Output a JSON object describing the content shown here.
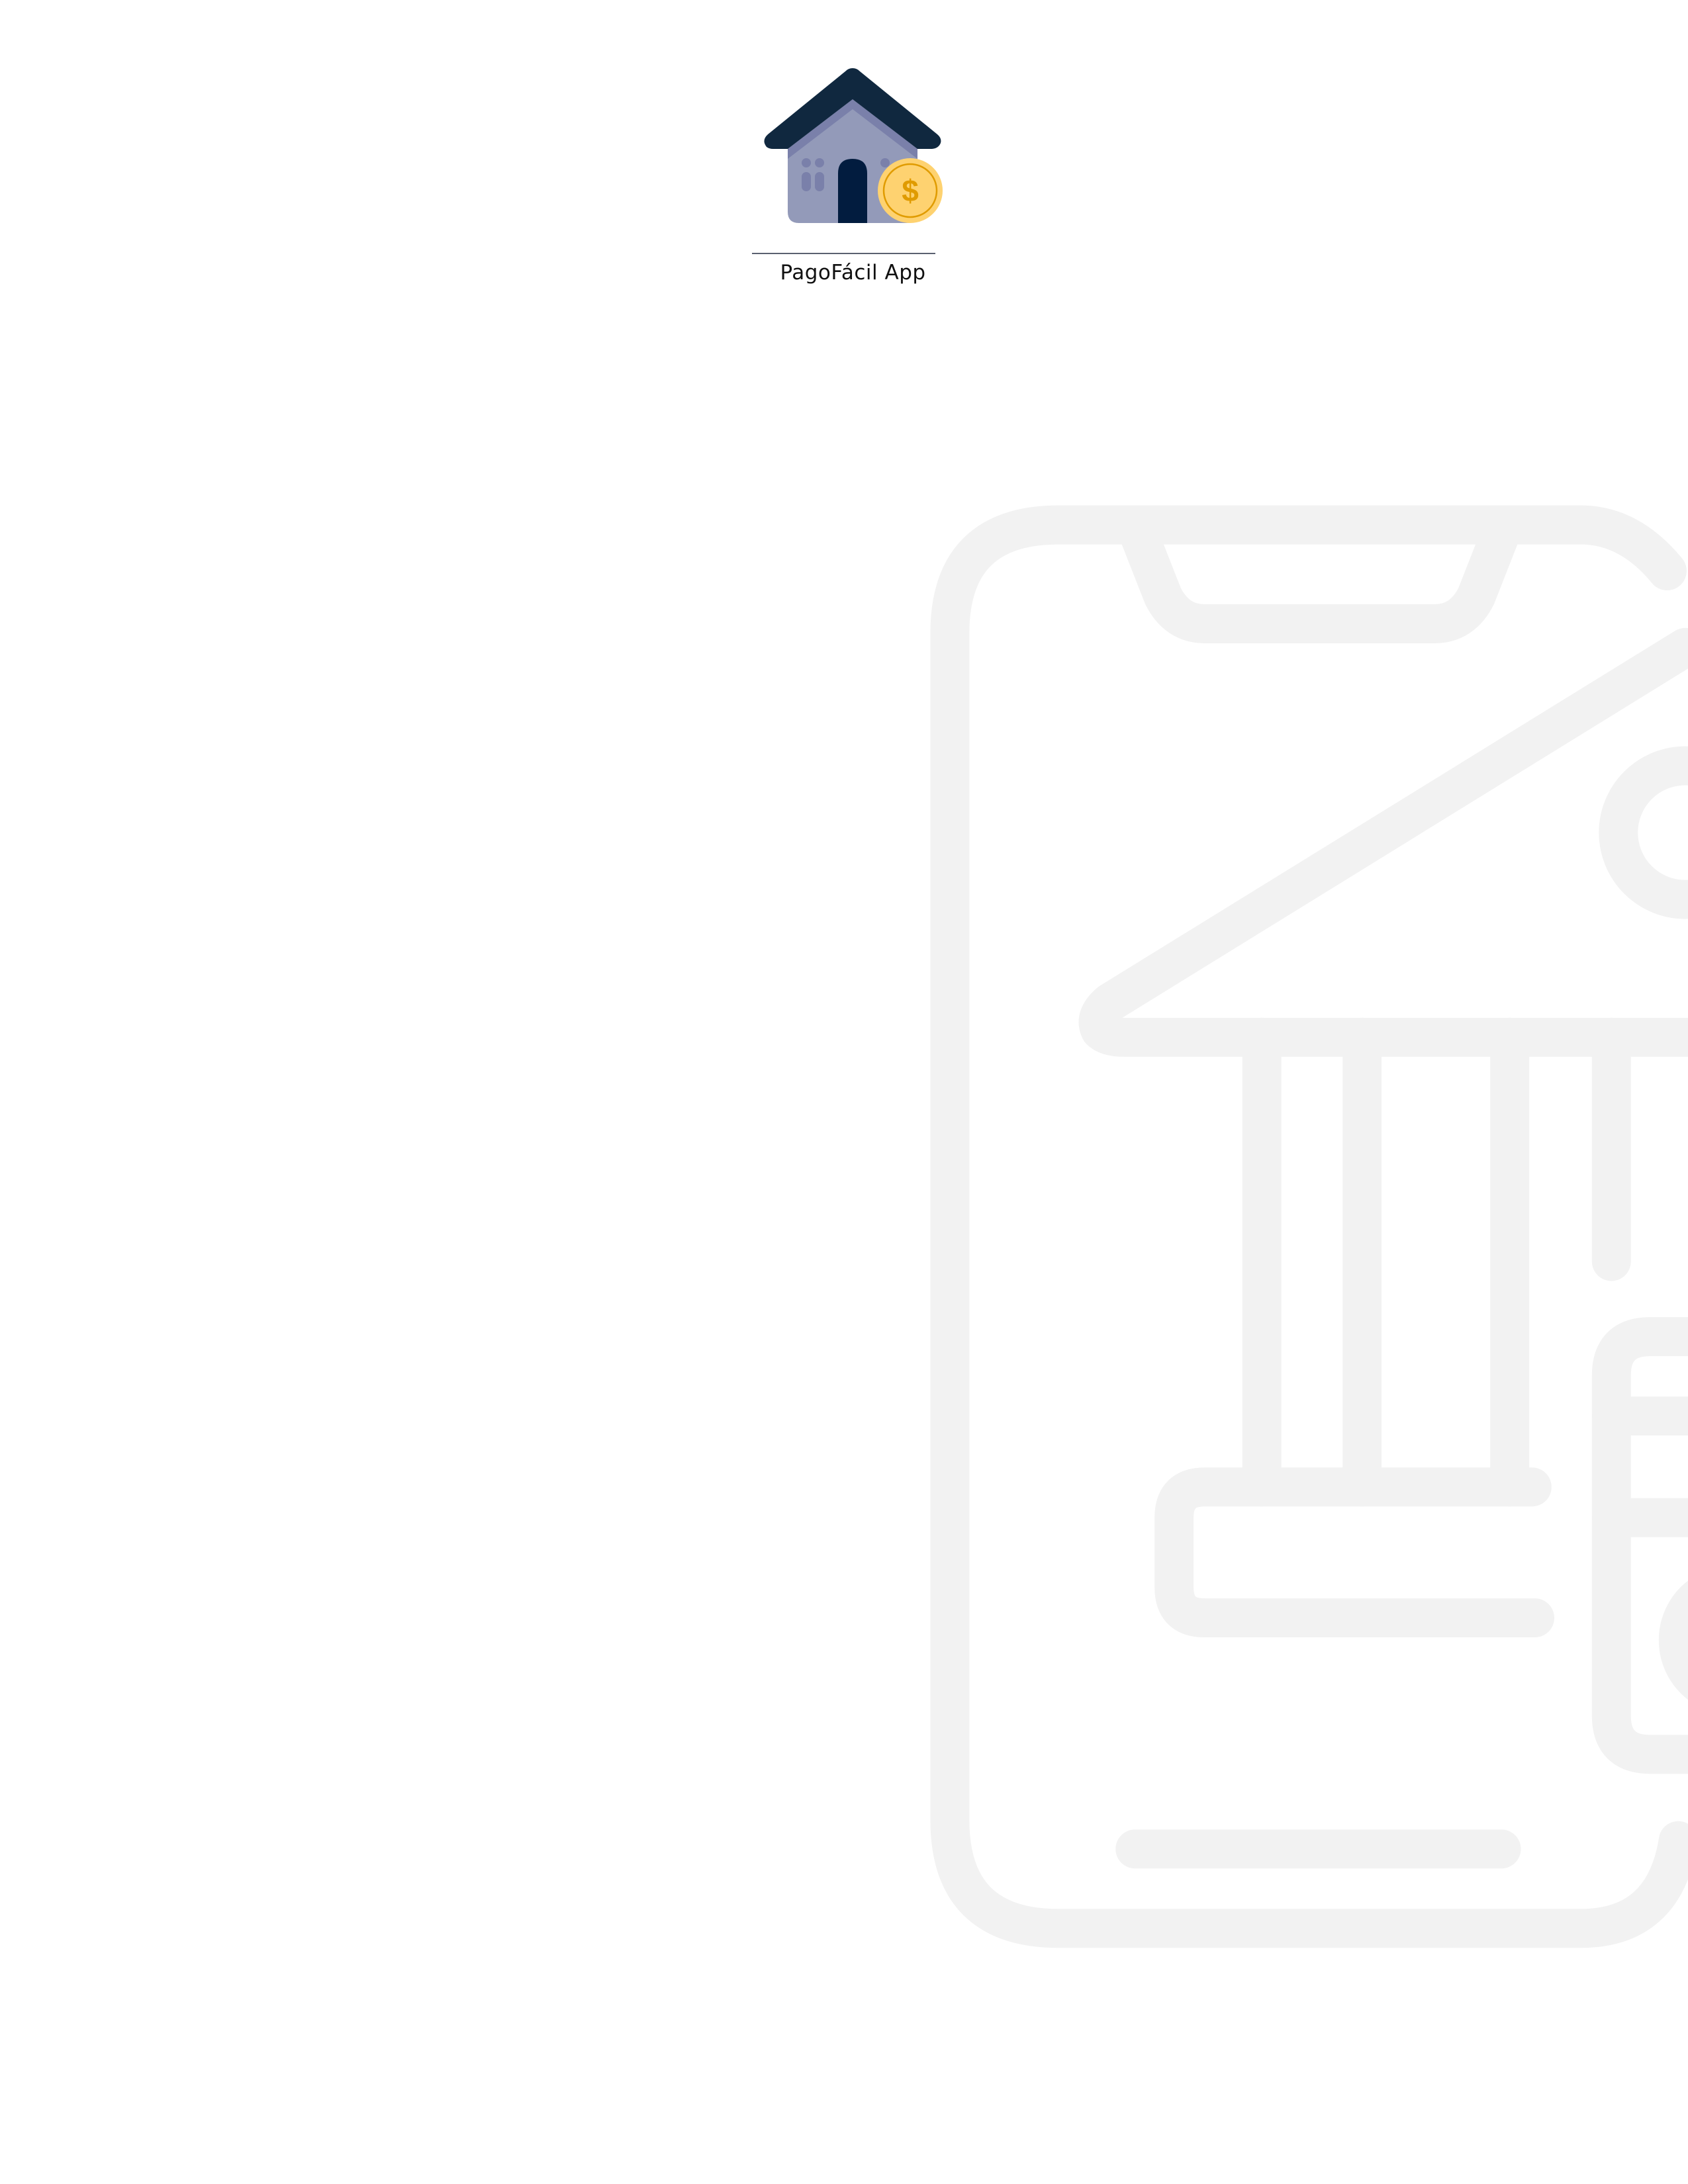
{
  "app": {
    "name": "PagoFácil App",
    "logo_icon": "house-with-coin-icon",
    "watermark_icon": "mobile-banking-icon"
  },
  "colors": {
    "roof": "#10283f",
    "house_wall": "#939ab9",
    "house_detail": "#7a80aa",
    "door": "#021c3f",
    "coin": "#fed270",
    "coin_detail": "#e09b00",
    "watermark": "#f2f2f2",
    "divider": "#5a6070"
  }
}
